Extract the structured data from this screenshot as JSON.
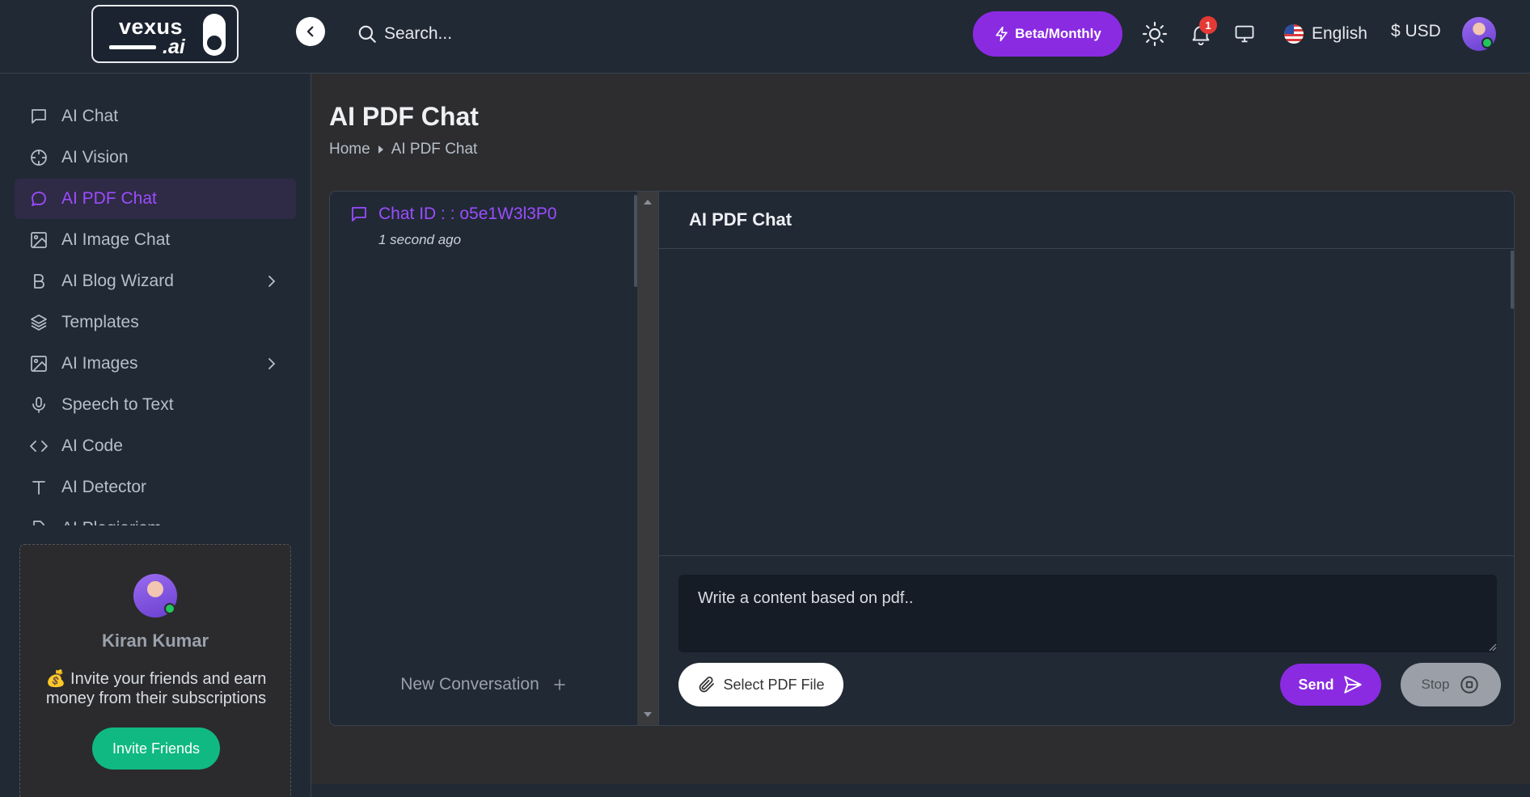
{
  "header": {
    "logo_word": "vexus",
    "logo_sub": ".ai",
    "search_placeholder": "Search...",
    "plan_label": "Beta/Monthly",
    "notification_count": "1",
    "language": "English",
    "currency": "$ USD"
  },
  "sidebar": {
    "items": [
      {
        "label": "AI Chat",
        "icon": "chat-square-icon"
      },
      {
        "label": "AI Vision",
        "icon": "crosshair-icon"
      },
      {
        "label": "AI PDF Chat",
        "icon": "chat-bubble-icon",
        "active": true
      },
      {
        "label": "AI Image Chat",
        "icon": "image-icon"
      },
      {
        "label": "AI Blog Wizard",
        "icon": "bold-b-icon",
        "has_submenu": true
      },
      {
        "label": "Templates",
        "icon": "layers-icon"
      },
      {
        "label": "AI Images",
        "icon": "image-icon",
        "has_submenu": true
      },
      {
        "label": "Speech to Text",
        "icon": "microphone-icon"
      },
      {
        "label": "AI Code",
        "icon": "code-icon"
      },
      {
        "label": "AI Detector",
        "icon": "text-t-icon"
      },
      {
        "label": "AI Plagiarism",
        "icon": "document-icon"
      }
    ],
    "promo": {
      "name": "Kiran Kumar",
      "text": "💰 Invite your friends and earn money from their subscriptions",
      "button": "Invite Friends"
    }
  },
  "main": {
    "title": "AI PDF Chat",
    "breadcrumb": {
      "home": "Home",
      "current": "AI PDF Chat"
    },
    "conversations": [
      {
        "id_label": "Chat ID : : o5e1W3l3P0",
        "time": "1 second ago"
      }
    ],
    "new_conversation": "New Conversation",
    "chat_title": "AI PDF Chat",
    "prompt_placeholder": "Write a content based on pdf..",
    "select_pdf": "Select PDF File",
    "send": "Send",
    "stop": "Stop"
  },
  "colors": {
    "accent": "#8a2be2",
    "active_text": "#9b4dff",
    "success": "#10b981",
    "header_bg": "#212935",
    "page_bg": "#2d2d2f"
  }
}
